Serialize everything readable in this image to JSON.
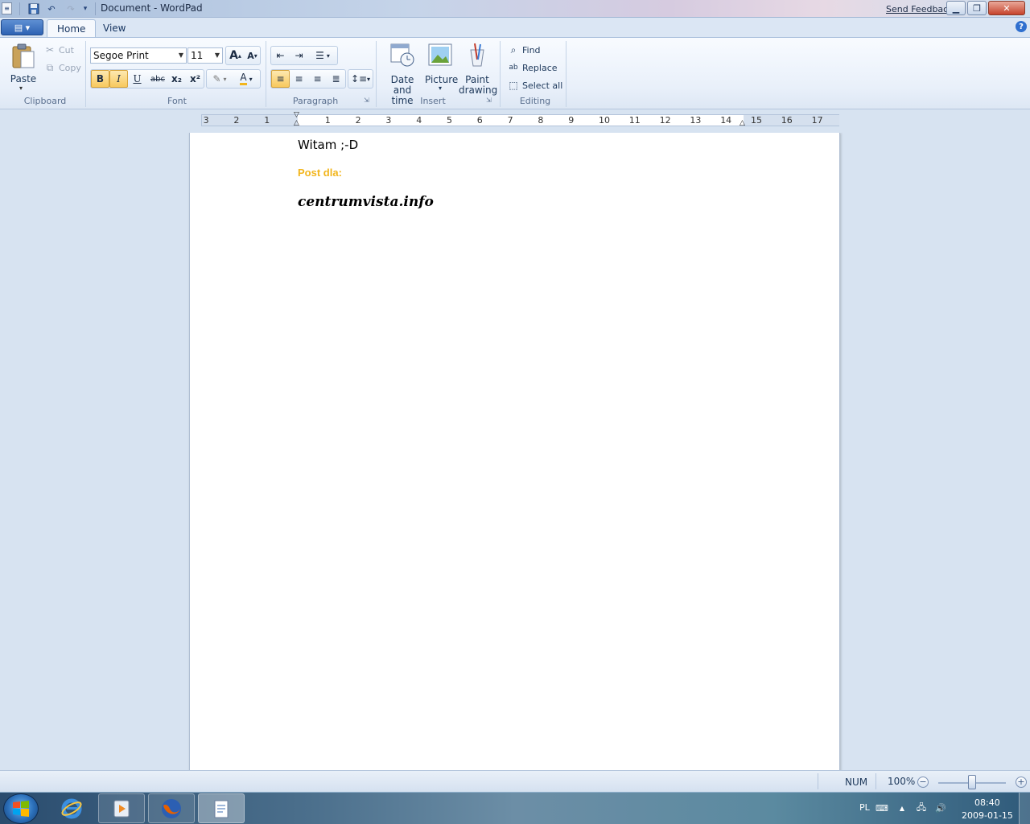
{
  "window": {
    "title": "Document - WordPad",
    "send_feedback": "Send Feedback"
  },
  "tabs": [
    "Home",
    "View"
  ],
  "clipboard": {
    "paste": "Paste",
    "cut": "Cut",
    "copy": "Copy",
    "group_label": "Clipboard"
  },
  "font": {
    "family": "Segoe Print",
    "size": "11",
    "group_label": "Font",
    "buttons": [
      "B",
      "I",
      "U",
      "abc",
      "x₂",
      "x²"
    ]
  },
  "paragraph": {
    "group_label": "Paragraph"
  },
  "insert": {
    "date_time": "Date and time",
    "picture": "Picture",
    "paint": "Paint drawing",
    "group_label": "Insert"
  },
  "editing": {
    "find": "Find",
    "replace": "Replace",
    "select_all": "Select all",
    "group_label": "Editing"
  },
  "ruler": {
    "ticks": [
      "3",
      "2",
      "1",
      "1",
      "2",
      "3",
      "4",
      "5",
      "6",
      "7",
      "8",
      "9",
      "10",
      "11",
      "12",
      "13",
      "14",
      "15",
      "16",
      "17"
    ]
  },
  "document": {
    "line1": "Witam ;-D",
    "line2": "Post dla:",
    "line3": "centrumvista.info"
  },
  "status": {
    "num": "NUM",
    "zoom": "100%"
  },
  "taskbar": {
    "lang": "PL",
    "time": "08:40",
    "date": "2009-01-15"
  },
  "colors": {
    "accent_yellow": "#f2b51c",
    "highlight_active": "#f8c95e"
  }
}
